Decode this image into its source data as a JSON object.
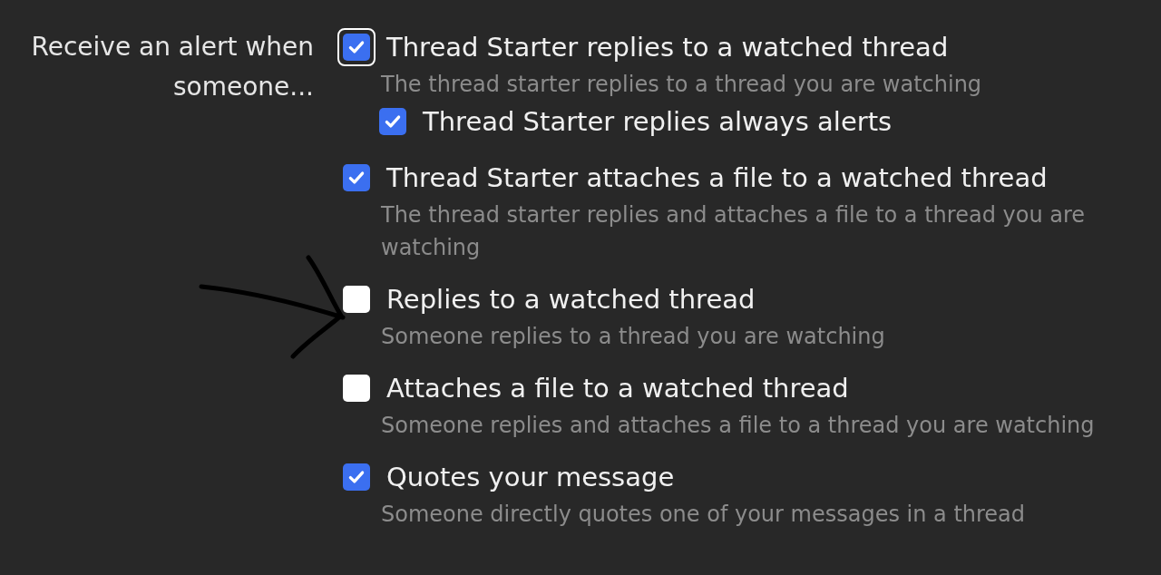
{
  "label": {
    "line1": "Receive an alert when",
    "line2": "someone..."
  },
  "options": [
    {
      "title": "Thread Starter replies to a watched thread",
      "description": "The thread starter replies to a thread you are watching",
      "checked": true,
      "focused": true,
      "children": [
        {
          "title": "Thread Starter replies always alerts",
          "checked": true,
          "focused": false
        }
      ]
    },
    {
      "title": "Thread Starter attaches a file to a watched thread",
      "description": "The thread starter replies and attaches a file to a thread you are watching",
      "checked": true,
      "focused": false
    },
    {
      "title": "Replies to a watched thread",
      "description": "Someone replies to a thread you are watching",
      "checked": false,
      "focused": false
    },
    {
      "title": "Attaches a file to a watched thread",
      "description": "Someone replies and attaches a file to a thread you are watching",
      "checked": false,
      "focused": false
    },
    {
      "title": "Quotes your message",
      "description": "Someone directly quotes one of your messages in a thread",
      "checked": true,
      "focused": false
    }
  ]
}
